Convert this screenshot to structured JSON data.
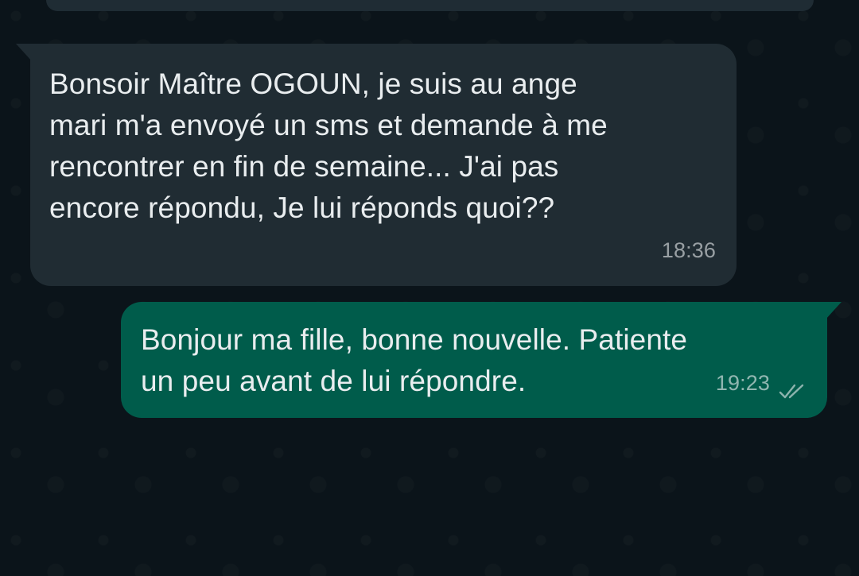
{
  "messages": [
    {
      "direction": "incoming",
      "text": "Bonsoir Maître OGOUN, je suis au ange\nmari m'a envoyé un sms et demande à me\nrencontrer en fin de semaine... J'ai  pas\nencore répondu, Je lui réponds quoi??",
      "time": "18:36"
    },
    {
      "direction": "outgoing",
      "text": "Bonjour ma fille, bonne nouvelle. Patiente\nun peu avant de lui répondre.",
      "time": "19:23",
      "status_icon": "double-check-icon"
    }
  ],
  "colors": {
    "background": "#0b141a",
    "incoming_bubble": "#202c33",
    "outgoing_bubble": "#005c4b"
  }
}
